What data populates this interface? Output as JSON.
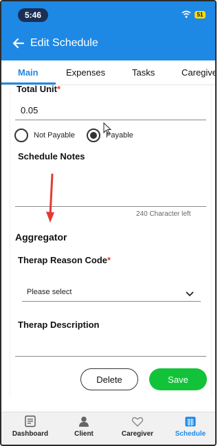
{
  "status_bar": {
    "time": "5:46",
    "battery": "51"
  },
  "app_bar": {
    "title": "Edit Schedule"
  },
  "tabs": [
    {
      "label": "Main",
      "active": true
    },
    {
      "label": "Expenses",
      "active": false
    },
    {
      "label": "Tasks",
      "active": false
    },
    {
      "label": "Caregiver",
      "active": false
    }
  ],
  "form": {
    "total_unit_label": "Total Unit",
    "required_mark": "*",
    "total_unit_value": "0.05",
    "radio_not_payable": "Not Payable",
    "radio_payable": "Payable",
    "payable_selected": true,
    "schedule_notes_label": "Schedule Notes",
    "schedule_notes_value": "",
    "char_counter": "240 Character left",
    "aggregator_heading": "Aggregator",
    "therap_reason_label": "Therap Reason Code",
    "therap_reason_value": "Please select",
    "therap_description_label": "Therap Description",
    "therap_description_value": ""
  },
  "actions": {
    "delete_label": "Delete",
    "save_label": "Save"
  },
  "bottom_nav": [
    {
      "label": "Dashboard",
      "icon": "dashboard-icon"
    },
    {
      "label": "Client",
      "icon": "client-icon"
    },
    {
      "label": "Caregiver",
      "icon": "caregiver-icon"
    },
    {
      "label": "Schedule",
      "icon": "schedule-icon",
      "active": true
    }
  ],
  "colors": {
    "primary": "#1e88e5",
    "save": "#12c33a",
    "required": "#e53935",
    "annotation_arrow": "#e53935"
  }
}
